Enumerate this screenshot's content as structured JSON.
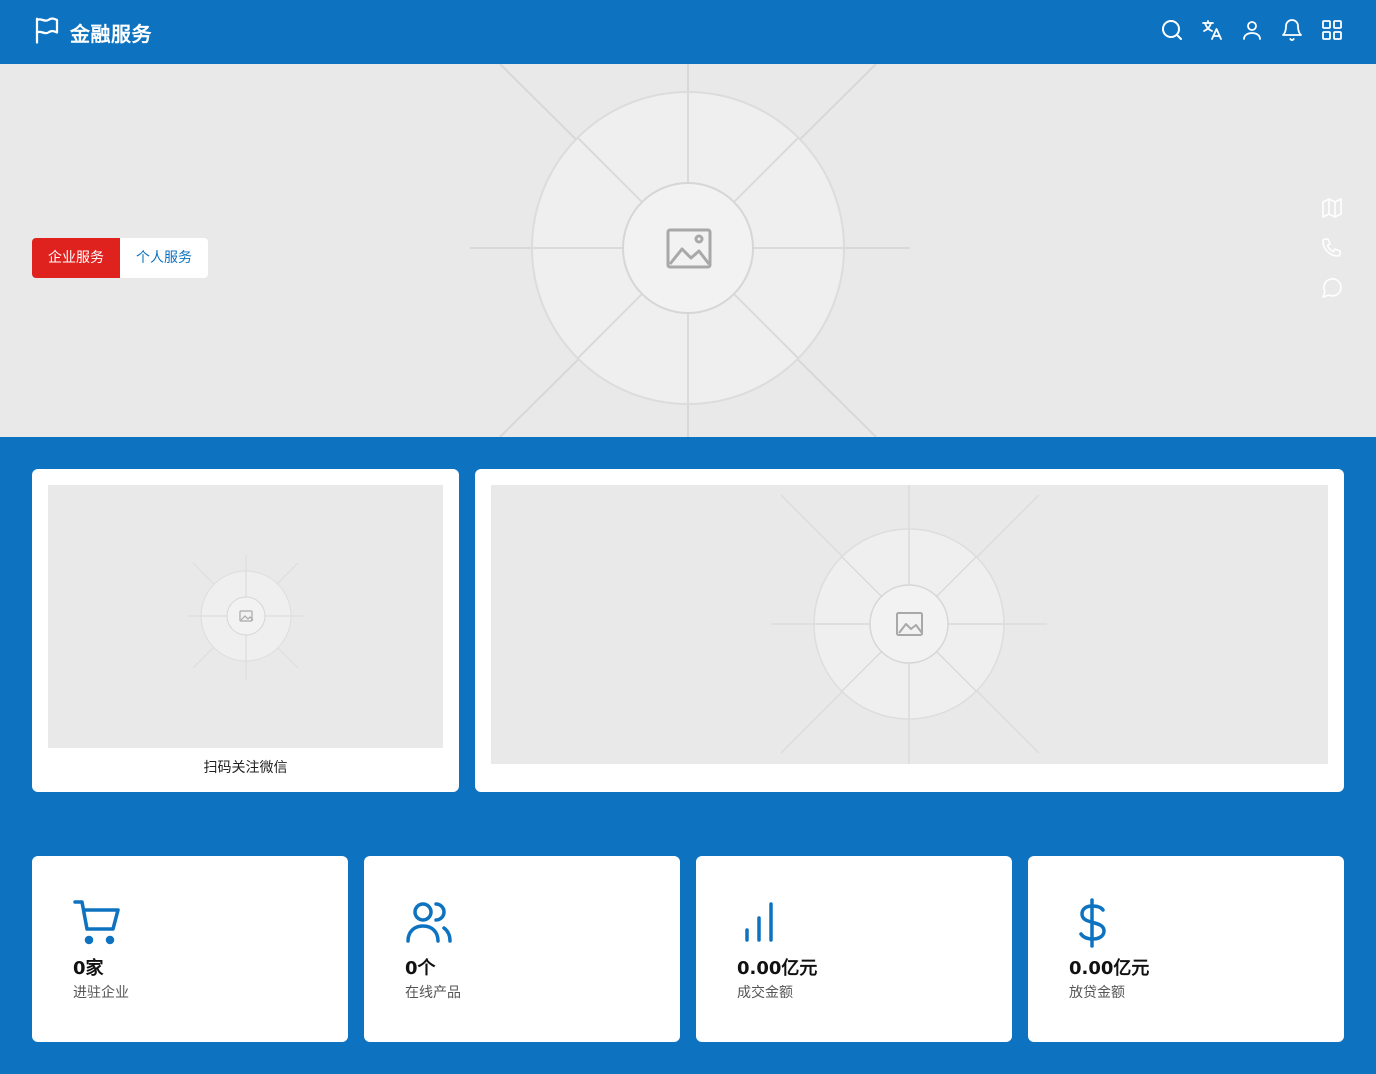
{
  "header": {
    "title": "金融服务",
    "icons": [
      "flag-icon",
      "search-icon",
      "translate-icon",
      "user-icon",
      "bell-icon",
      "apps-grid-icon"
    ]
  },
  "banner": {
    "tabs": [
      {
        "label": "企业服务",
        "active": true
      },
      {
        "label": "个人服务",
        "active": false
      }
    ],
    "side_icons": [
      "map-icon",
      "phone-icon",
      "chat-icon"
    ]
  },
  "qr_card": {
    "caption": "扫码关注微信"
  },
  "stats": [
    {
      "icon": "cart-icon",
      "value": "0家",
      "label": "进驻企业"
    },
    {
      "icon": "users-icon",
      "value": "0个",
      "label": "在线产品"
    },
    {
      "icon": "bar-chart-icon",
      "value": "0.00亿元",
      "label": "成交金额"
    },
    {
      "icon": "dollar-icon",
      "value": "0.00亿元",
      "label": "放贷金额"
    }
  ],
  "colors": {
    "primary": "#0d73c1",
    "accent_red": "#e0221f",
    "placeholder_bg": "#e9e9e9"
  }
}
